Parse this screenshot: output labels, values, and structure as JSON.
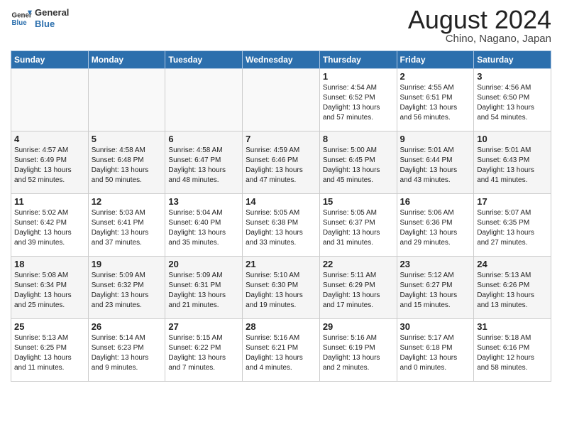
{
  "header": {
    "logo_line1": "General",
    "logo_line2": "Blue",
    "title": "August 2024",
    "subtitle": "Chino, Nagano, Japan"
  },
  "weekdays": [
    "Sunday",
    "Monday",
    "Tuesday",
    "Wednesday",
    "Thursday",
    "Friday",
    "Saturday"
  ],
  "weeks": [
    [
      {
        "day": "",
        "content": ""
      },
      {
        "day": "",
        "content": ""
      },
      {
        "day": "",
        "content": ""
      },
      {
        "day": "",
        "content": ""
      },
      {
        "day": "1",
        "content": "Sunrise: 4:54 AM\nSunset: 6:52 PM\nDaylight: 13 hours and 57 minutes."
      },
      {
        "day": "2",
        "content": "Sunrise: 4:55 AM\nSunset: 6:51 PM\nDaylight: 13 hours and 56 minutes."
      },
      {
        "day": "3",
        "content": "Sunrise: 4:56 AM\nSunset: 6:50 PM\nDaylight: 13 hours and 54 minutes."
      }
    ],
    [
      {
        "day": "4",
        "content": "Sunrise: 4:57 AM\nSunset: 6:49 PM\nDaylight: 13 hours and 52 minutes."
      },
      {
        "day": "5",
        "content": "Sunrise: 4:58 AM\nSunset: 6:48 PM\nDaylight: 13 hours and 50 minutes."
      },
      {
        "day": "6",
        "content": "Sunrise: 4:58 AM\nSunset: 6:47 PM\nDaylight: 13 hours and 48 minutes."
      },
      {
        "day": "7",
        "content": "Sunrise: 4:59 AM\nSunset: 6:46 PM\nDaylight: 13 hours and 47 minutes."
      },
      {
        "day": "8",
        "content": "Sunrise: 5:00 AM\nSunset: 6:45 PM\nDaylight: 13 hours and 45 minutes."
      },
      {
        "day": "9",
        "content": "Sunrise: 5:01 AM\nSunset: 6:44 PM\nDaylight: 13 hours and 43 minutes."
      },
      {
        "day": "10",
        "content": "Sunrise: 5:01 AM\nSunset: 6:43 PM\nDaylight: 13 hours and 41 minutes."
      }
    ],
    [
      {
        "day": "11",
        "content": "Sunrise: 5:02 AM\nSunset: 6:42 PM\nDaylight: 13 hours and 39 minutes."
      },
      {
        "day": "12",
        "content": "Sunrise: 5:03 AM\nSunset: 6:41 PM\nDaylight: 13 hours and 37 minutes."
      },
      {
        "day": "13",
        "content": "Sunrise: 5:04 AM\nSunset: 6:40 PM\nDaylight: 13 hours and 35 minutes."
      },
      {
        "day": "14",
        "content": "Sunrise: 5:05 AM\nSunset: 6:38 PM\nDaylight: 13 hours and 33 minutes."
      },
      {
        "day": "15",
        "content": "Sunrise: 5:05 AM\nSunset: 6:37 PM\nDaylight: 13 hours and 31 minutes."
      },
      {
        "day": "16",
        "content": "Sunrise: 5:06 AM\nSunset: 6:36 PM\nDaylight: 13 hours and 29 minutes."
      },
      {
        "day": "17",
        "content": "Sunrise: 5:07 AM\nSunset: 6:35 PM\nDaylight: 13 hours and 27 minutes."
      }
    ],
    [
      {
        "day": "18",
        "content": "Sunrise: 5:08 AM\nSunset: 6:34 PM\nDaylight: 13 hours and 25 minutes."
      },
      {
        "day": "19",
        "content": "Sunrise: 5:09 AM\nSunset: 6:32 PM\nDaylight: 13 hours and 23 minutes."
      },
      {
        "day": "20",
        "content": "Sunrise: 5:09 AM\nSunset: 6:31 PM\nDaylight: 13 hours and 21 minutes."
      },
      {
        "day": "21",
        "content": "Sunrise: 5:10 AM\nSunset: 6:30 PM\nDaylight: 13 hours and 19 minutes."
      },
      {
        "day": "22",
        "content": "Sunrise: 5:11 AM\nSunset: 6:29 PM\nDaylight: 13 hours and 17 minutes."
      },
      {
        "day": "23",
        "content": "Sunrise: 5:12 AM\nSunset: 6:27 PM\nDaylight: 13 hours and 15 minutes."
      },
      {
        "day": "24",
        "content": "Sunrise: 5:13 AM\nSunset: 6:26 PM\nDaylight: 13 hours and 13 minutes."
      }
    ],
    [
      {
        "day": "25",
        "content": "Sunrise: 5:13 AM\nSunset: 6:25 PM\nDaylight: 13 hours and 11 minutes."
      },
      {
        "day": "26",
        "content": "Sunrise: 5:14 AM\nSunset: 6:23 PM\nDaylight: 13 hours and 9 minutes."
      },
      {
        "day": "27",
        "content": "Sunrise: 5:15 AM\nSunset: 6:22 PM\nDaylight: 13 hours and 7 minutes."
      },
      {
        "day": "28",
        "content": "Sunrise: 5:16 AM\nSunset: 6:21 PM\nDaylight: 13 hours and 4 minutes."
      },
      {
        "day": "29",
        "content": "Sunrise: 5:16 AM\nSunset: 6:19 PM\nDaylight: 13 hours and 2 minutes."
      },
      {
        "day": "30",
        "content": "Sunrise: 5:17 AM\nSunset: 6:18 PM\nDaylight: 13 hours and 0 minutes."
      },
      {
        "day": "31",
        "content": "Sunrise: 5:18 AM\nSunset: 6:16 PM\nDaylight: 12 hours and 58 minutes."
      }
    ]
  ]
}
